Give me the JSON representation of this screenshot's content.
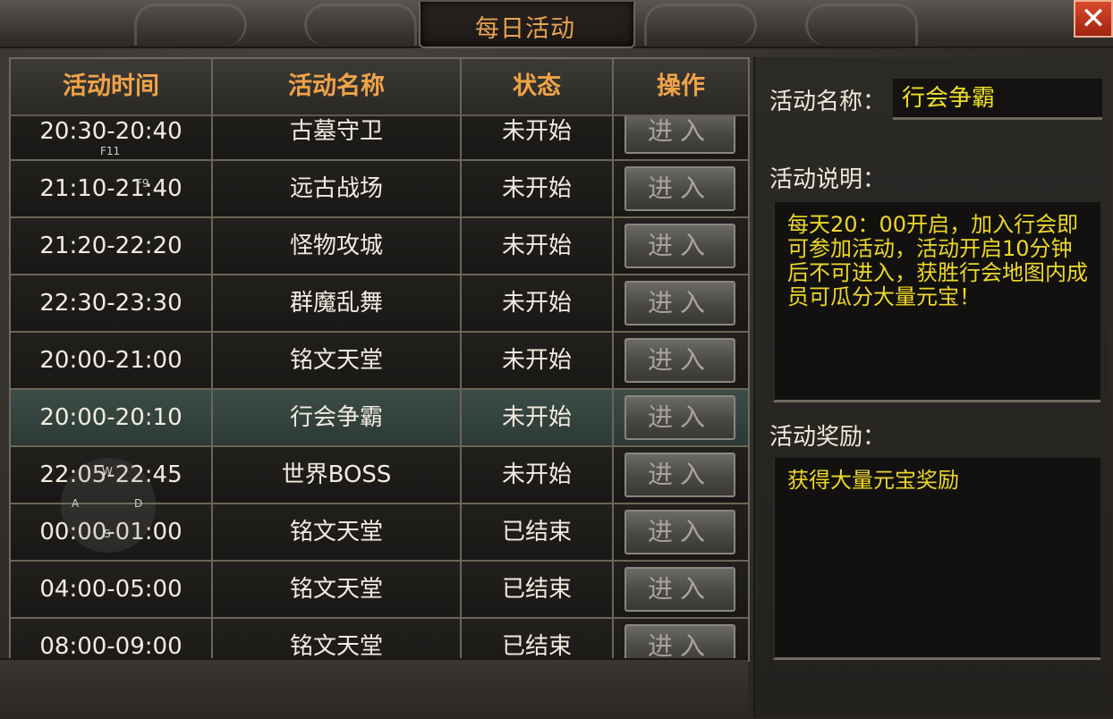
{
  "window": {
    "title": "每日活动",
    "close_icon": "close-icon"
  },
  "table": {
    "headers": [
      "活动时间",
      "活动名称",
      "状态",
      "操作"
    ],
    "rows": [
      {
        "time": "20:30-20:40",
        "name": "古墓守卫",
        "status": "未开始",
        "action": "进入"
      },
      {
        "time": "21:10-21:40",
        "name": "远古战场",
        "status": "未开始",
        "action": "进入"
      },
      {
        "time": "21:20-22:20",
        "name": "怪物攻城",
        "status": "未开始",
        "action": "进入"
      },
      {
        "time": "22:30-23:30",
        "name": "群魔乱舞",
        "status": "未开始",
        "action": "进入"
      },
      {
        "time": "20:00-21:00",
        "name": "铭文天堂",
        "status": "未开始",
        "action": "进入"
      },
      {
        "time": "20:00-20:10",
        "name": "行会争霸",
        "status": "未开始",
        "action": "进入",
        "selected": true
      },
      {
        "time": "22:05-22:45",
        "name": "世界BOSS",
        "status": "未开始",
        "action": "进入"
      },
      {
        "time": "00:00-01:00",
        "name": "铭文天堂",
        "status": "已结束",
        "action": "进入"
      },
      {
        "time": "04:00-05:00",
        "name": "铭文天堂",
        "status": "已结束",
        "action": "进入"
      },
      {
        "time": "08:00-09:00",
        "name": "铭文天堂",
        "status": "已结束",
        "action": "进入"
      }
    ]
  },
  "overlay_hints": {
    "f11": "F11",
    "f9": "F9",
    "w": "W",
    "a": "A",
    "s": "S",
    "d": "D"
  },
  "detail": {
    "name_label": "活动名称：",
    "name_value": "行会争霸",
    "desc_label": "活动说明：",
    "desc_text": "每天20：00开启，加入行会即可参加活动，活动开启10分钟后不可进入，获胜行会地图内成员可瓜分大量元宝！",
    "reward_label": "活动奖励：",
    "reward_text": "获得大量元宝奖励"
  },
  "colors": {
    "title": "#e8a354",
    "header": "#f0a348",
    "highlight_text": "#ecd82a",
    "close": "#c0321a",
    "selected_row": "#3c4c47"
  }
}
